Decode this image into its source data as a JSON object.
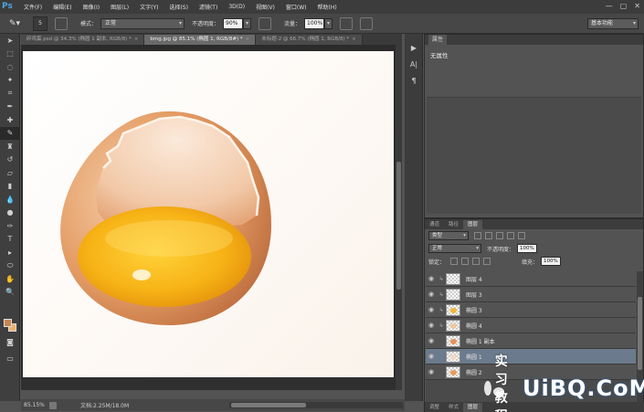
{
  "app": {
    "logo": "Ps",
    "menu": [
      "文件(F)",
      "编辑(E)",
      "图像(I)",
      "图层(L)",
      "文字(Y)",
      "选择(S)",
      "滤镜(T)",
      "3D(D)",
      "视图(V)",
      "窗口(W)",
      "帮助(H)"
    ],
    "window_controls": [
      "—",
      "▢",
      "✕"
    ]
  },
  "options_bar": {
    "brush_size": "5",
    "mode_label": "模式：",
    "mode_value": "正常",
    "opacity_label": "不透明度：",
    "opacity_value": "90%",
    "flow_label": "流量：",
    "flow_value": "100%",
    "workspace": "基本功能"
  },
  "tabs": [
    {
      "label": "碎鸡蛋.psd @ 34.3% (椭圆 1 副本, RGB/8) *",
      "close": "×"
    },
    {
      "label": "bmg.jpg @ 85.1% (椭圆 1, RGB/8#) *",
      "close": "×"
    },
    {
      "label": "未标题-2 @ 66.7% (椭圆 1, RGB/8) *",
      "close": "×"
    }
  ],
  "status": {
    "zoom": "85.15%",
    "doc": "文档:2.25M/18.0M"
  },
  "properties": {
    "tab": "属性",
    "text": "无属性"
  },
  "layers_panel": {
    "tabs": [
      "通道",
      "路径",
      "图层"
    ],
    "filter_kind": "类型",
    "blend_mode": "正常",
    "opacity_label": "不透明度：",
    "opacity_value": "100%",
    "lock_label": "锁定：",
    "fill_label": "填充：",
    "fill_value": "100%",
    "layers": [
      {
        "name": "图层 4",
        "selected": false,
        "linked": true,
        "thumb": ""
      },
      {
        "name": "图层 3",
        "selected": false,
        "linked": true,
        "thumb": ""
      },
      {
        "name": "椭圆 3",
        "selected": false,
        "linked": true,
        "thumb": "#f2b833"
      },
      {
        "name": "椭圆 4",
        "selected": false,
        "linked": true,
        "thumb": "#f1c7a0"
      },
      {
        "name": "椭圆 1 副本",
        "selected": false,
        "linked": false,
        "thumb": "#e8905a"
      },
      {
        "name": "椭圆 1",
        "selected": true,
        "linked": false,
        "thumb": "#f3d8c6"
      },
      {
        "name": "椭圆 2",
        "selected": false,
        "linked": false,
        "thumb": "#e89b5d"
      }
    ],
    "bottom_tabs": [
      "调整",
      "样式",
      "图层"
    ]
  },
  "watermark": {
    "text": "实习教程",
    "logo": "UiBQ.CoM"
  },
  "colors": {
    "foreground": "#c9864f",
    "background": "#f0b070",
    "selected_layer": "#6b7a8c"
  }
}
